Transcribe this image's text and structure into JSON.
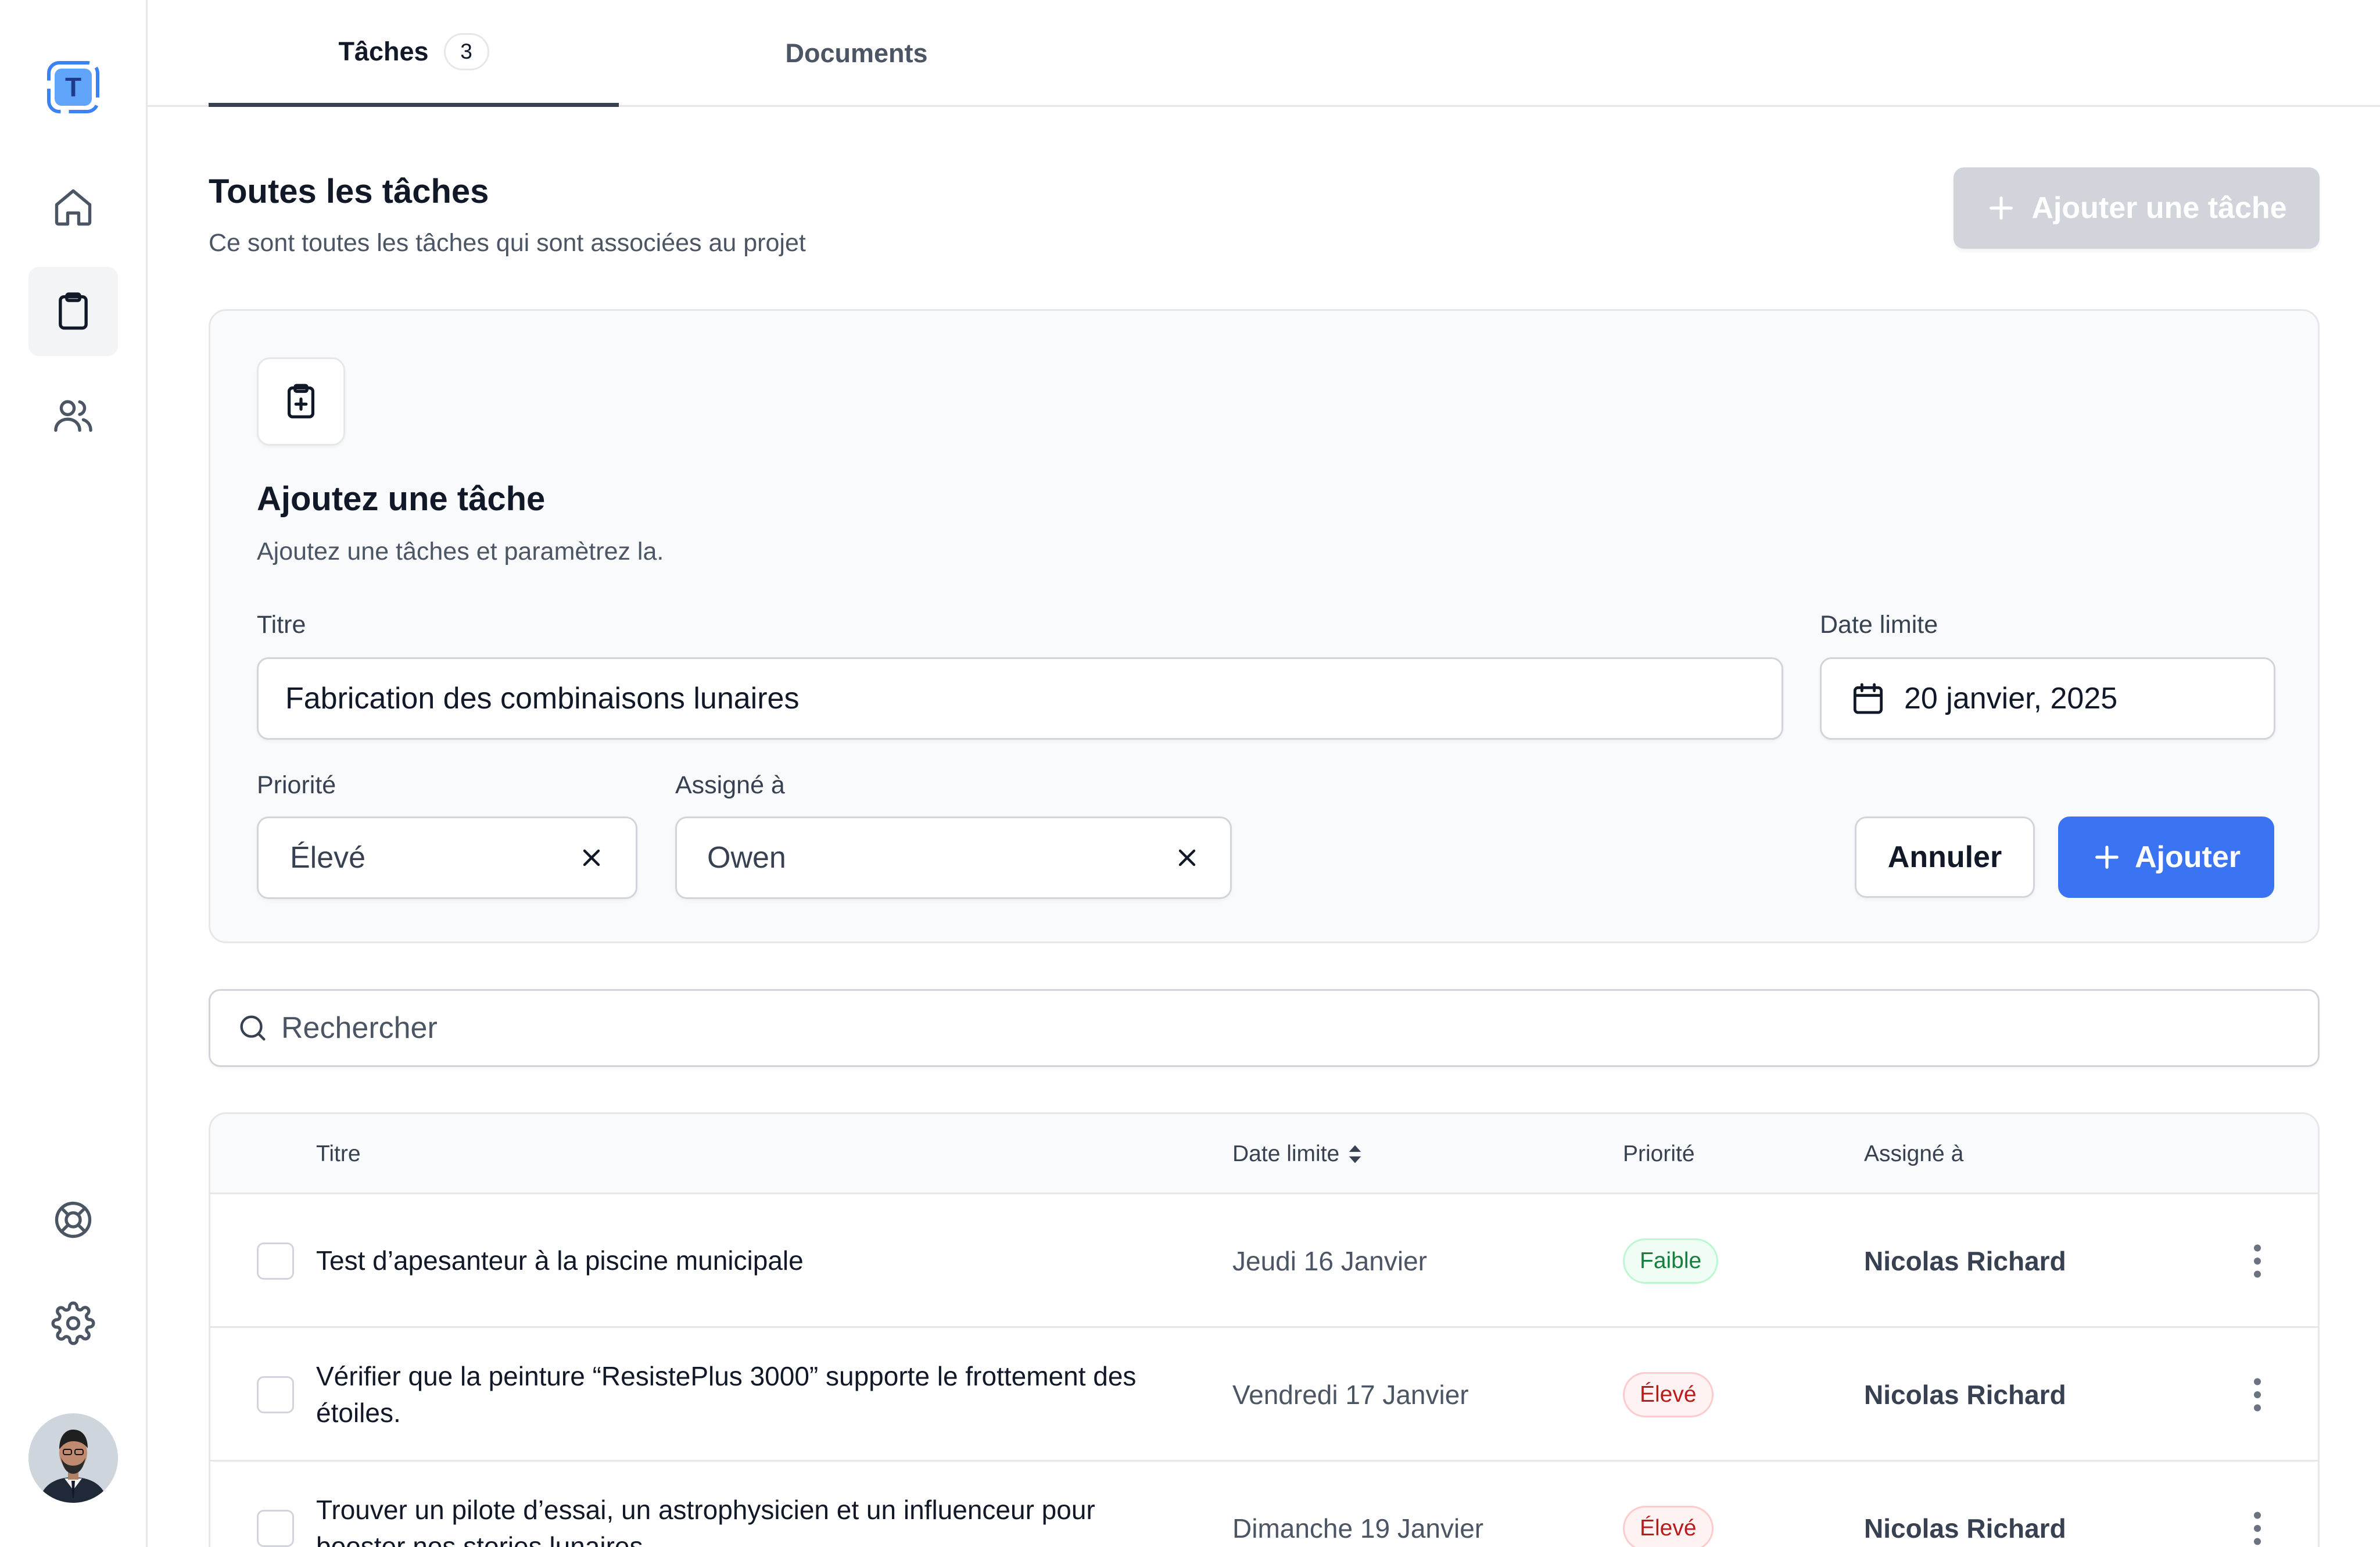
{
  "sidebar": {
    "logo_letter": "T",
    "nav": [
      {
        "name": "home-icon",
        "active": false
      },
      {
        "name": "clipboard-icon",
        "active": true
      },
      {
        "name": "users-icon",
        "active": false
      }
    ],
    "bottom": [
      {
        "name": "support-icon"
      },
      {
        "name": "gear-icon"
      }
    ]
  },
  "tabs": [
    {
      "label": "Tâches",
      "count": "3",
      "active": true
    },
    {
      "label": "Documents",
      "active": false
    }
  ],
  "header": {
    "title": "Toutes les tâches",
    "subtitle": "Ce sont toutes les tâches qui sont associées au projet",
    "add_button": "Ajouter une tâche"
  },
  "form": {
    "title": "Ajoutez une tâche",
    "subtitle": "Ajoutez une tâches et paramètrez la.",
    "title_label": "Titre",
    "title_value": "Fabrication des combinaisons lunaires",
    "date_label": "Date limite",
    "date_value": "20 janvier, 2025",
    "priority_label": "Priorité",
    "priority_value": "Élevé",
    "assignee_label": "Assigné à",
    "assignee_value": "Owen",
    "cancel_label": "Annuler",
    "submit_label": "Ajouter"
  },
  "search": {
    "placeholder": "Rechercher"
  },
  "table": {
    "columns": {
      "title": "Titre",
      "date": "Date limite",
      "priority": "Priorité",
      "assignee": "Assigné à"
    },
    "rows": [
      {
        "title": "Test d’apesanteur à la piscine municipale",
        "date": "Jeudi 16 Janvier",
        "priority": "Faible",
        "priority_level": "low",
        "assignee": "Nicolas Richard"
      },
      {
        "title": "Vérifier que la peinture “ResistePlus 3000” supporte le frottement des étoiles.",
        "date": "Vendredi 17 Janvier",
        "priority": "Élevé",
        "priority_level": "high",
        "assignee": "Nicolas Richard"
      },
      {
        "title": "Trouver un pilote d’essai, un astrophysicien et un influenceur pour booster nos stories lunaires",
        "date": "Dimanche 19 Janvier",
        "priority": "Élevé",
        "priority_level": "high",
        "assignee": "Nicolas Richard"
      }
    ]
  },
  "colors": {
    "accent": "#3b74f2",
    "logo": "#3b82f6",
    "disabled_button": "#d1d5db"
  }
}
